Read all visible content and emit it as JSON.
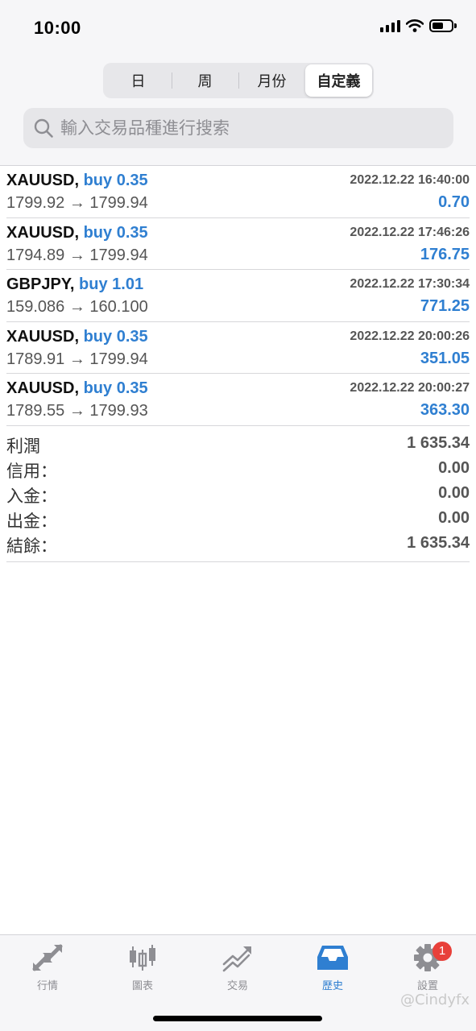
{
  "status_bar": {
    "time": "10:00"
  },
  "period_tabs": [
    {
      "label": "日",
      "active": false
    },
    {
      "label": "周",
      "active": false
    },
    {
      "label": "月份",
      "active": false
    },
    {
      "label": "自定義",
      "active": true
    }
  ],
  "search": {
    "placeholder": "輸入交易品種進行搜索",
    "icon": "search-icon"
  },
  "deals": [
    {
      "symbol": "XAUUSD,",
      "side": "buy 0.35",
      "time": "2022.12.22 16:40:00",
      "prices": "1799.92 → 1799.94",
      "profit": "0.70"
    },
    {
      "symbol": "XAUUSD,",
      "side": "buy 0.35",
      "time": "2022.12.22 17:46:26",
      "prices": "1794.89 → 1799.94",
      "profit": "176.75"
    },
    {
      "symbol": "GBPJPY,",
      "side": "buy 1.01",
      "time": "2022.12.22 17:30:34",
      "prices": "159.086 → 160.100",
      "profit": "771.25"
    },
    {
      "symbol": "XAUUSD,",
      "side": "buy 0.35",
      "time": "2022.12.22 20:00:26",
      "prices": "1789.91 → 1799.94",
      "profit": "351.05"
    },
    {
      "symbol": "XAUUSD,",
      "side": "buy 0.35",
      "time": "2022.12.22 20:00:27",
      "prices": "1789.55 → 1799.93",
      "profit": "363.30"
    }
  ],
  "summary": [
    {
      "label": "利潤",
      "value": "1 635.34"
    },
    {
      "label": "信用：",
      "value": "0.00"
    },
    {
      "label": "入金：",
      "value": "0.00"
    },
    {
      "label": "出金：",
      "value": "0.00"
    },
    {
      "label": "結餘：",
      "value": "1 635.34"
    }
  ],
  "tabbar": [
    {
      "label": "行情",
      "icon": "quotes-arrows-icon",
      "active": false
    },
    {
      "label": "圖表",
      "icon": "candlestick-chart-icon",
      "active": false
    },
    {
      "label": "交易",
      "icon": "trade-trend-icon",
      "active": false
    },
    {
      "label": "歷史",
      "icon": "history-inbox-icon",
      "active": true
    },
    {
      "label": "設置",
      "icon": "settings-gear-icon",
      "active": false,
      "badge": "1"
    }
  ],
  "watermark": "@Cindyfx",
  "colors": {
    "accent": "#2f7fd1",
    "badge": "#e8403a",
    "background": "#f6f6f8"
  }
}
